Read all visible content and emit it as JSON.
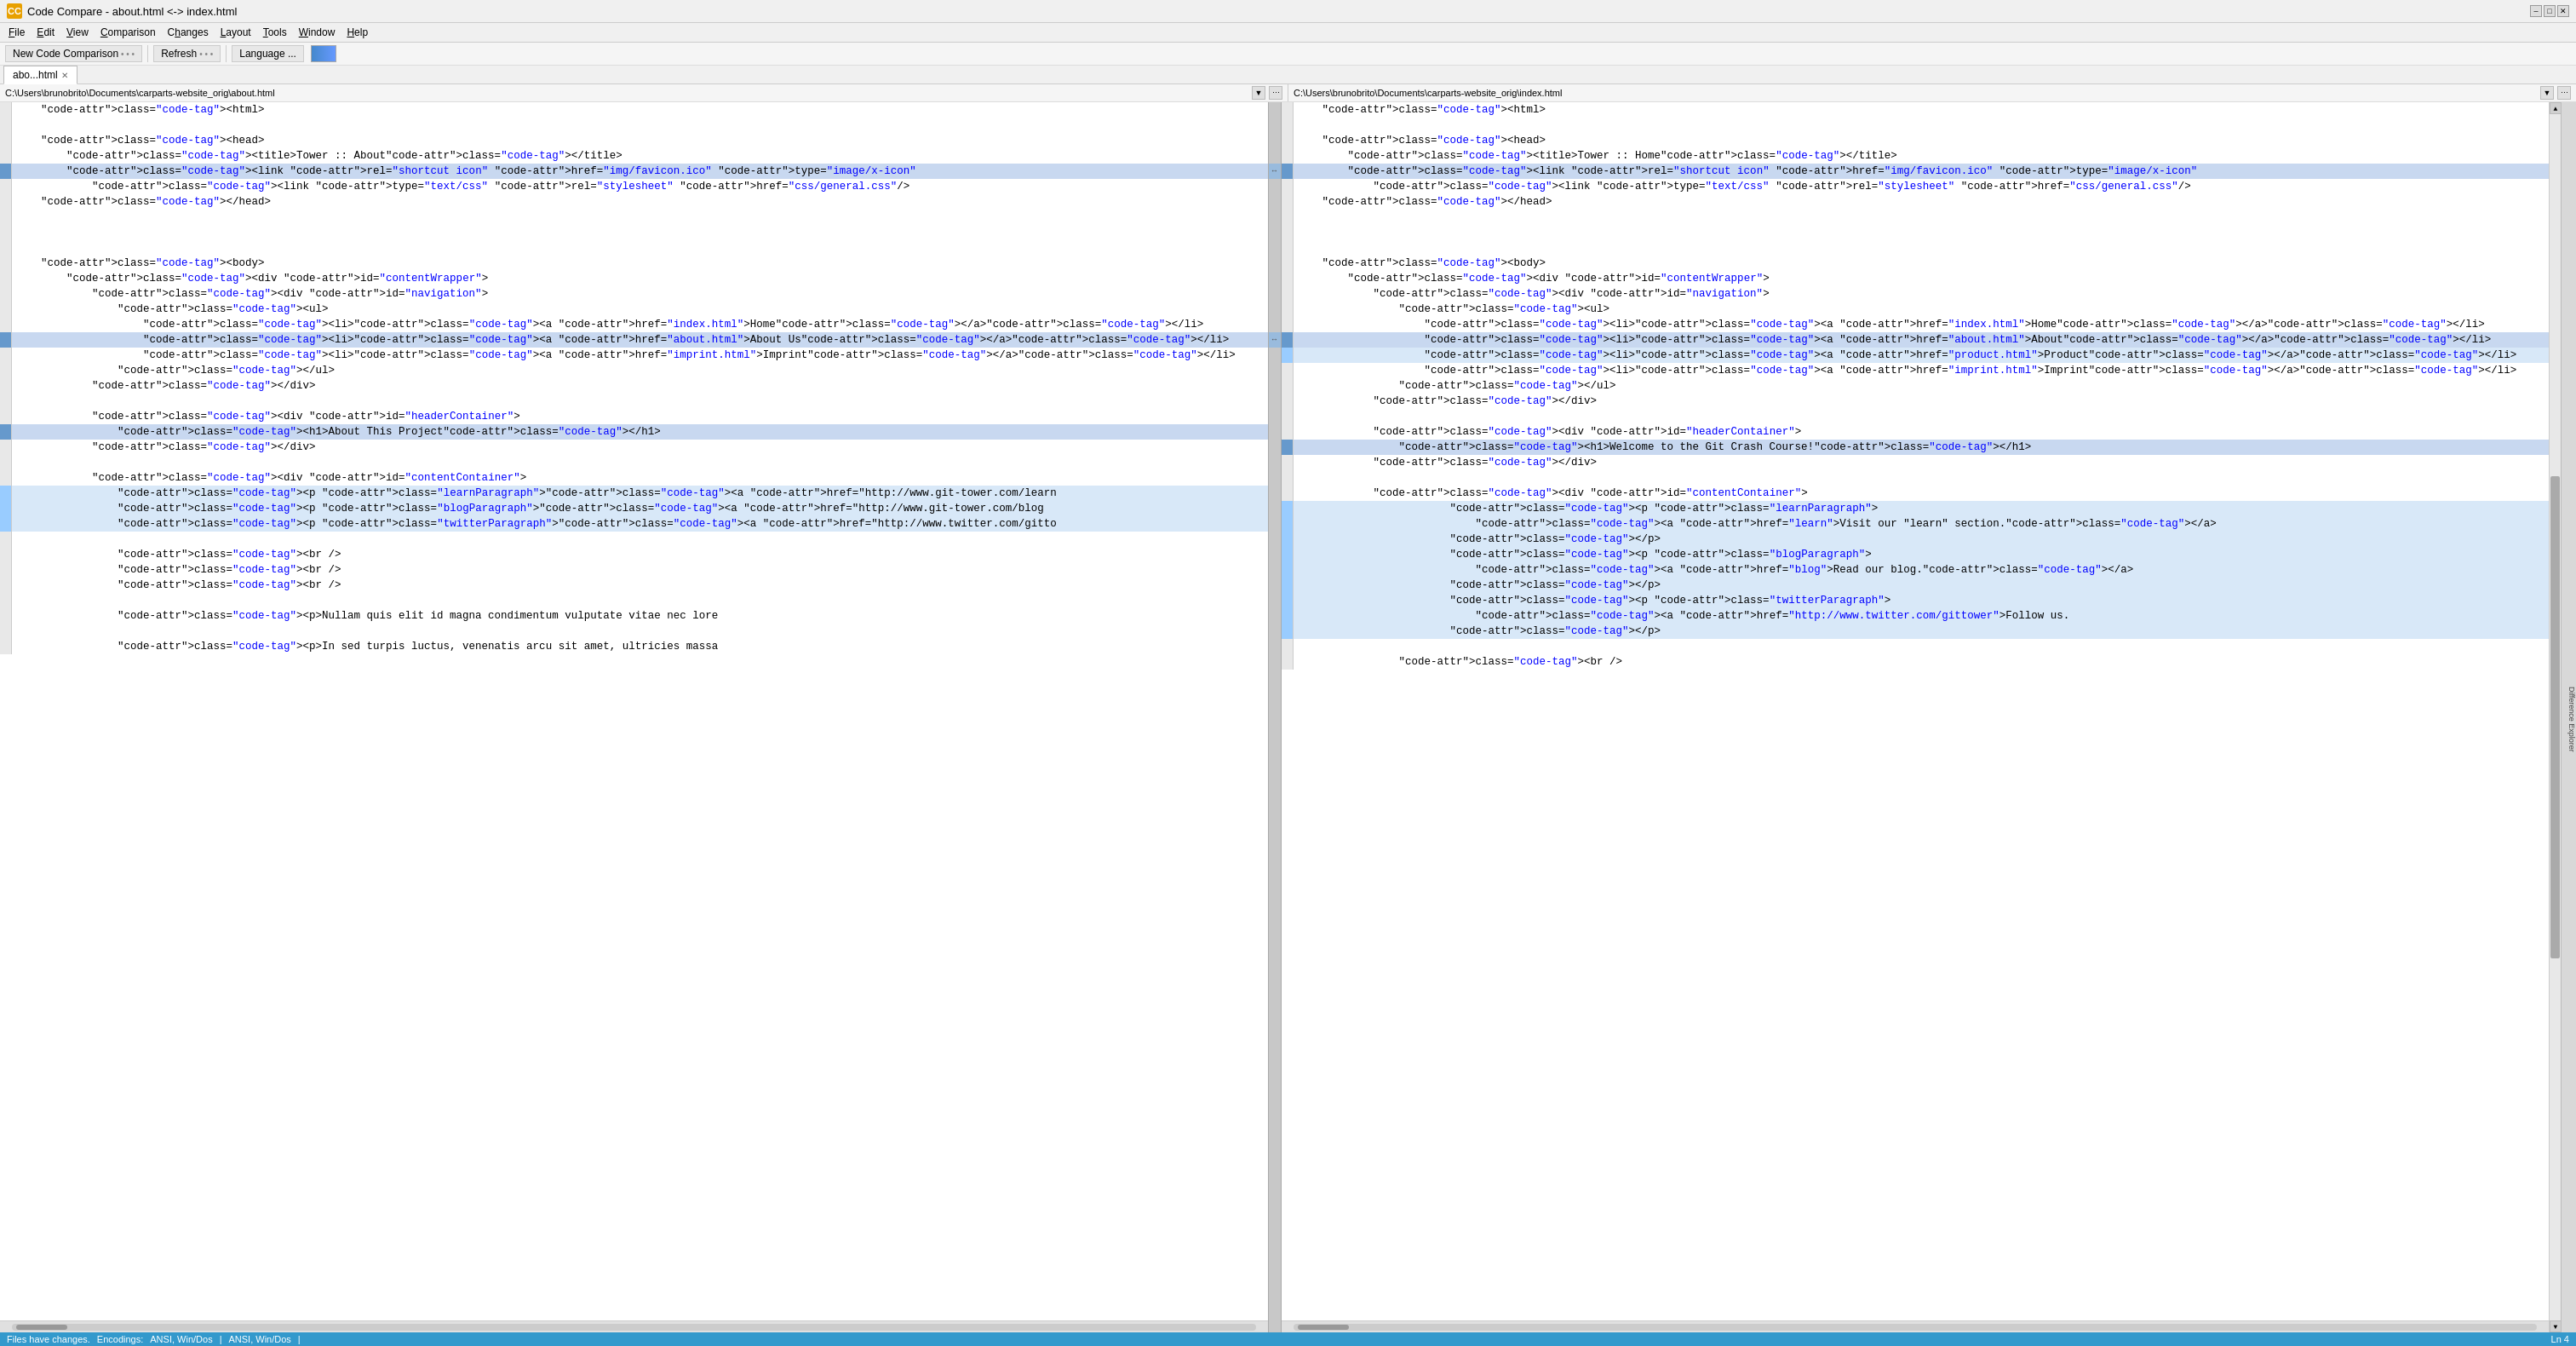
{
  "titleBar": {
    "appIcon": "CC",
    "title": "Code Compare - about.html <-> index.html",
    "winMinLabel": "–",
    "winMaxLabel": "□",
    "winCloseLabel": "✕"
  },
  "menuBar": {
    "items": [
      "File",
      "Edit",
      "View",
      "Comparison",
      "Changes",
      "Layout",
      "Tools",
      "Window",
      "Help"
    ]
  },
  "toolbar": {
    "newBtn": "New Code Comparison",
    "refreshBtn": "Refresh",
    "languageBtn": "Language ...",
    "dots1": "• • •",
    "dots2": "• • •"
  },
  "tabs": [
    {
      "label": "abo...html",
      "active": true
    }
  ],
  "leftPath": "C:\\Users\\brunobrito\\Documents\\carparts-website_orig\\about.html",
  "rightPath": "C:\\Users\\brunobrito\\Documents\\carparts-website_orig\\index.html",
  "leftLines": [
    {
      "gutter": "",
      "content": "    <html>"
    },
    {
      "gutter": "",
      "content": ""
    },
    {
      "gutter": "",
      "content": "    <head>"
    },
    {
      "gutter": "",
      "content": "        <title>Tower :: About</title>"
    },
    {
      "gutter": "changed",
      "content": "        <link rel=\"shortcut icon\" href=\"img/favicon.ico\" type=\"image/x-icon\""
    },
    {
      "gutter": "",
      "content": "            <link type=\"text/css\" rel=\"stylesheet\" href=\"css/general.css\"/>"
    },
    {
      "gutter": "",
      "content": "    </head>"
    },
    {
      "gutter": "",
      "content": ""
    },
    {
      "gutter": "",
      "content": ""
    },
    {
      "gutter": "",
      "content": ""
    },
    {
      "gutter": "",
      "content": "    <body>"
    },
    {
      "gutter": "",
      "content": "        <div id=\"contentWrapper\">"
    },
    {
      "gutter": "",
      "content": "            <div id=\"navigation\">"
    },
    {
      "gutter": "",
      "content": "                <ul>"
    },
    {
      "gutter": "",
      "content": "                    <li><a href=\"index.html\">Home</a></li>"
    },
    {
      "gutter": "changed",
      "content": "                    <li><a href=\"about.html\">About Us</a></li>"
    },
    {
      "gutter": "",
      "content": "                    <li><a href=\"imprint.html\">Imprint</a></li>"
    },
    {
      "gutter": "",
      "content": "                </ul>"
    },
    {
      "gutter": "",
      "content": "            </div>"
    },
    {
      "gutter": "",
      "content": ""
    },
    {
      "gutter": "",
      "content": "            <div id=\"headerContainer\">"
    },
    {
      "gutter": "changed",
      "content": "                <h1>About This Project</h1>"
    },
    {
      "gutter": "",
      "content": "            </div>"
    },
    {
      "gutter": "",
      "content": ""
    },
    {
      "gutter": "",
      "content": "            <div id=\"contentContainer\">"
    },
    {
      "gutter": "blue-line",
      "content": "                <p class=\"learnParagraph\"><a href=\"http://www.git-tower.com/learn"
    },
    {
      "gutter": "blue-line",
      "content": "                <p class=\"blogParagraph\"><a href=\"http://www.git-tower.com/blog"
    },
    {
      "gutter": "blue-line",
      "content": "                <p class=\"twitterParagraph\"><a href=\"http://www.twitter.com/gitto"
    },
    {
      "gutter": "",
      "content": ""
    },
    {
      "gutter": "",
      "content": "                <br />"
    },
    {
      "gutter": "",
      "content": "                <br />"
    },
    {
      "gutter": "",
      "content": "                <br />"
    },
    {
      "gutter": "",
      "content": ""
    },
    {
      "gutter": "",
      "content": "                <p>Nullam quis elit id magna condimentum vulputate vitae nec lore"
    },
    {
      "gutter": "",
      "content": ""
    },
    {
      "gutter": "",
      "content": "                <p>In sed turpis luctus, venenatis arcu sit amet, ultricies massa"
    }
  ],
  "rightLines": [
    {
      "gutter": "",
      "content": "    <html>"
    },
    {
      "gutter": "",
      "content": ""
    },
    {
      "gutter": "",
      "content": "    <head>"
    },
    {
      "gutter": "",
      "content": "        <title>Tower :: Home</title>"
    },
    {
      "gutter": "changed",
      "content": "        <link rel=\"shortcut icon\" href=\"img/favicon.ico\" type=\"image/x-icon\""
    },
    {
      "gutter": "",
      "content": "            <link type=\"text/css\" rel=\"stylesheet\" href=\"css/general.css\"/>"
    },
    {
      "gutter": "",
      "content": "    </head>"
    },
    {
      "gutter": "",
      "content": ""
    },
    {
      "gutter": "",
      "content": ""
    },
    {
      "gutter": "",
      "content": ""
    },
    {
      "gutter": "",
      "content": "    <body>"
    },
    {
      "gutter": "",
      "content": "        <div id=\"contentWrapper\">"
    },
    {
      "gutter": "",
      "content": "            <div id=\"navigation\">"
    },
    {
      "gutter": "",
      "content": "                <ul>"
    },
    {
      "gutter": "",
      "content": "                    <li><a href=\"index.html\">Home</a></li>"
    },
    {
      "gutter": "changed",
      "content": "                    <li><a href=\"about.html\">About</a></li>"
    },
    {
      "gutter": "added",
      "content": "                    <li><a href=\"product.html\">Product</a></li>"
    },
    {
      "gutter": "",
      "content": "                    <li><a href=\"imprint.html\">Imprint</a></li>"
    },
    {
      "gutter": "",
      "content": "                </ul>"
    },
    {
      "gutter": "",
      "content": "            </div>"
    },
    {
      "gutter": "",
      "content": ""
    },
    {
      "gutter": "",
      "content": "            <div id=\"headerContainer\">"
    },
    {
      "gutter": "changed",
      "content": "                <h1>Welcome to the Git Crash Course!</h1>"
    },
    {
      "gutter": "",
      "content": "            </div>"
    },
    {
      "gutter": "",
      "content": ""
    },
    {
      "gutter": "",
      "content": "            <div id=\"contentContainer\">"
    },
    {
      "gutter": "blue-line",
      "content": "                        <p class=\"learnParagraph\">"
    },
    {
      "gutter": "blue-line",
      "content": "                            <a href=\"learn\">Visit our \"learn\" section.</a>"
    },
    {
      "gutter": "blue-line",
      "content": "                        </p>"
    },
    {
      "gutter": "blue-line",
      "content": "                        <p class=\"blogParagraph\">"
    },
    {
      "gutter": "blue-line",
      "content": "                            <a href=\"blog\">Read our blog.</a>"
    },
    {
      "gutter": "blue-line",
      "content": "                        </p>"
    },
    {
      "gutter": "blue-line",
      "content": "                        <p class=\"twitterParagraph\">"
    },
    {
      "gutter": "blue-line",
      "content": "                            <a href=\"http://www.twitter.com/gittower\">Follow us."
    },
    {
      "gutter": "blue-line",
      "content": "                        </p>"
    },
    {
      "gutter": "",
      "content": ""
    },
    {
      "gutter": "",
      "content": "                <br />"
    }
  ],
  "statusBar": {
    "filesStatus": "Files have changes.",
    "encodingsLabel": "Encodings:",
    "leftEncoding": "ANSI, Win/Dos",
    "sep1": "|",
    "rightEncoding": "ANSI, Win/Dos",
    "sep2": "|",
    "lineInfo": "Ln 4"
  },
  "diffExplorer": {
    "label": "Difference Explorer"
  }
}
